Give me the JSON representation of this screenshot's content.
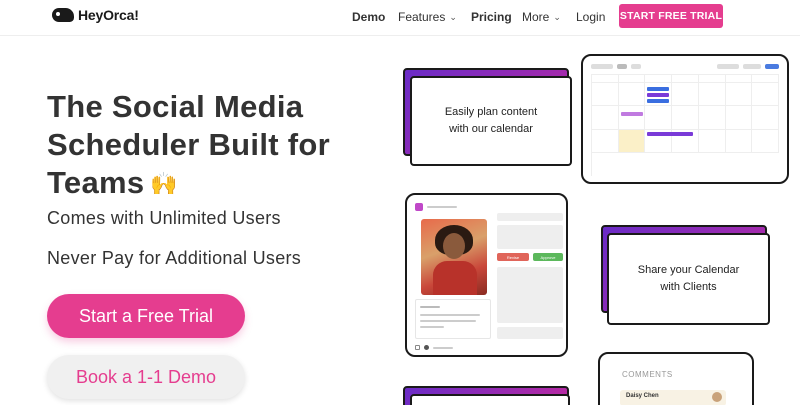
{
  "brand": {
    "name": "HeyOrca!"
  },
  "nav": {
    "links": [
      {
        "label": "Demo",
        "has_dropdown": false
      },
      {
        "label": "Features",
        "has_dropdown": true
      },
      {
        "label": "Pricing",
        "has_dropdown": false
      },
      {
        "label": "More",
        "has_dropdown": true
      },
      {
        "label": "Login",
        "has_dropdown": false
      }
    ],
    "cta": "START FREE TRIAL"
  },
  "hero": {
    "title_line1": "The Social Media",
    "title_line2": "Scheduler Built for",
    "title_line3": "Teams",
    "emoji": "🙌",
    "subtitle1": "Comes with Unlimited Users",
    "subtitle2": "Never Pay for Additional Users",
    "primary_button": "Start a Free Trial",
    "secondary_button": "Book a 1-1 Demo"
  },
  "features": {
    "calendar_card": "Easily plan content with our calendar",
    "share_card": "Share your Calendar with Clients",
    "post_badges": {
      "revise": "Revise",
      "approve": "Approve"
    },
    "comments_label": "COMMENTS",
    "comment_author": "Daisy Chen"
  },
  "colors": {
    "accent": "#e53d8f",
    "text": "#333333",
    "card_gradient_start": "#6a2cc7",
    "card_gradient_end": "#c02aa0",
    "approve": "#5cb85c",
    "revise": "#e0655a"
  }
}
